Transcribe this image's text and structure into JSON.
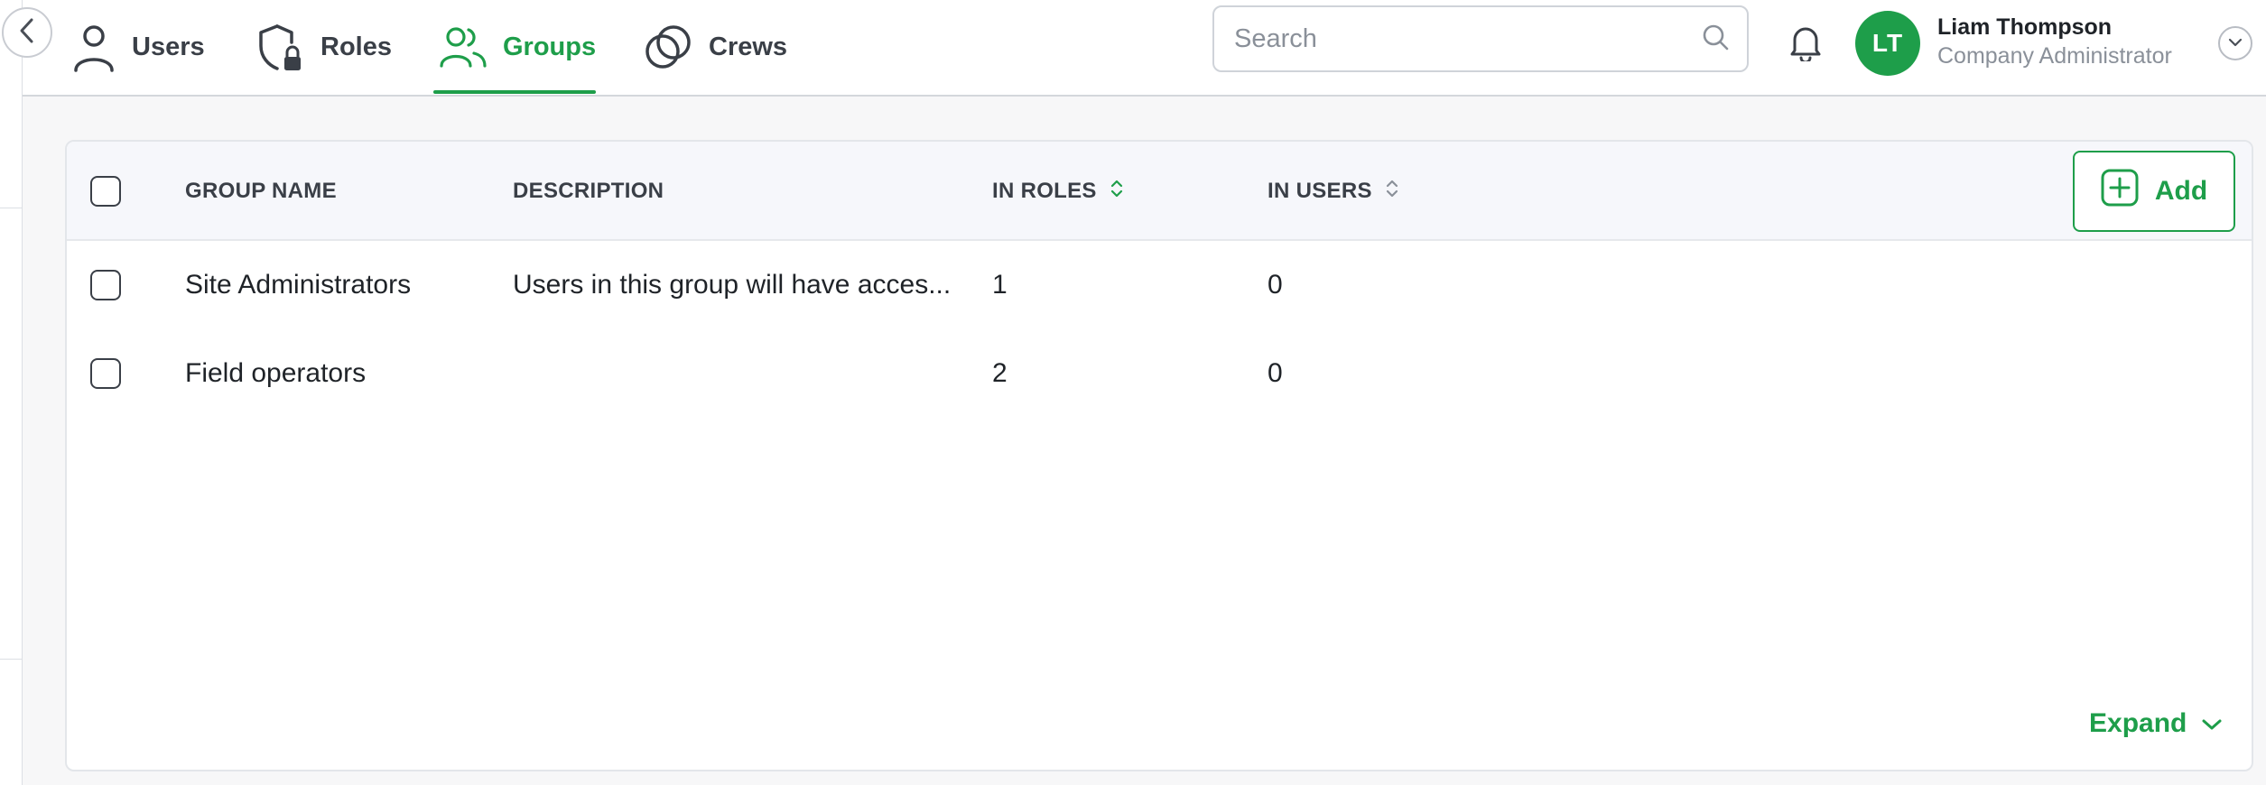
{
  "nav": {
    "tabs": [
      {
        "label": "Users",
        "icon": "user-icon"
      },
      {
        "label": "Roles",
        "icon": "shield-lock-icon"
      },
      {
        "label": "Groups",
        "icon": "group-icon",
        "active": true
      },
      {
        "label": "Crews",
        "icon": "crews-icon"
      }
    ]
  },
  "search": {
    "placeholder": "Search",
    "value": ""
  },
  "user": {
    "initials": "LT",
    "name": "Liam Thompson",
    "role": "Company Administrator"
  },
  "table": {
    "columns": {
      "name": "GROUP NAME",
      "description": "DESCRIPTION",
      "in_roles": "IN ROLES",
      "in_users": "IN USERS"
    },
    "add_label": "Add",
    "rows": [
      {
        "name": "Site Administrators",
        "description": "Users in this group will have acces...",
        "in_roles": "1",
        "in_users": "0"
      },
      {
        "name": "Field operators",
        "description": "",
        "in_roles": "2",
        "in_users": "0"
      }
    ],
    "expand_label": "Expand"
  },
  "colors": {
    "accent": "#1e9e4a",
    "text": "#1f2328",
    "muted": "#8a9099"
  }
}
